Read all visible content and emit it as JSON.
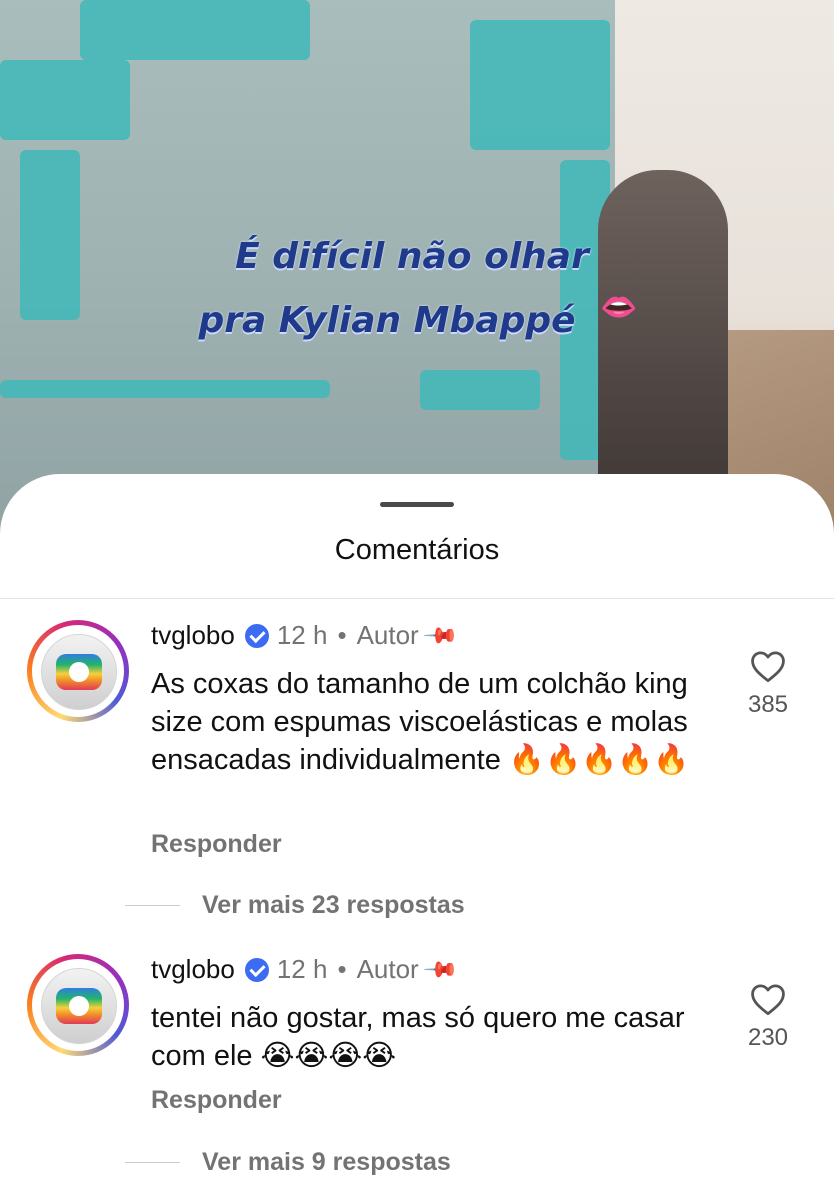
{
  "video": {
    "caption_line1": "É difícil não olhar",
    "caption_line2": "pra Kylian Mbappé",
    "caption_emoji": "👄"
  },
  "sheet": {
    "title": "Comentários"
  },
  "comments": [
    {
      "username": "tvglobo",
      "time": "12 h",
      "separator": "•",
      "role": "Autor",
      "text": "As coxas do tamanho de um colchão king size com espumas viscoelásticas e molas ensacadas individualmente 🔥🔥🔥🔥🔥",
      "likes": "385",
      "reply_label": "Responder",
      "more_replies": "Ver mais 23 respostas"
    },
    {
      "username": "tvglobo",
      "time": "12 h",
      "separator": "•",
      "role": "Autor",
      "text": "tentei não gostar, mas só quero me casar com ele 😭😭😭😭",
      "likes": "230",
      "reply_label": "Responder",
      "more_replies": "Ver mais 9 respostas"
    }
  ],
  "colors": {
    "verified_badge": "#3b6cf2",
    "caption_text": "#1f3a8a"
  },
  "icons": [
    "verified-icon",
    "pin-icon",
    "heart-icon"
  ]
}
